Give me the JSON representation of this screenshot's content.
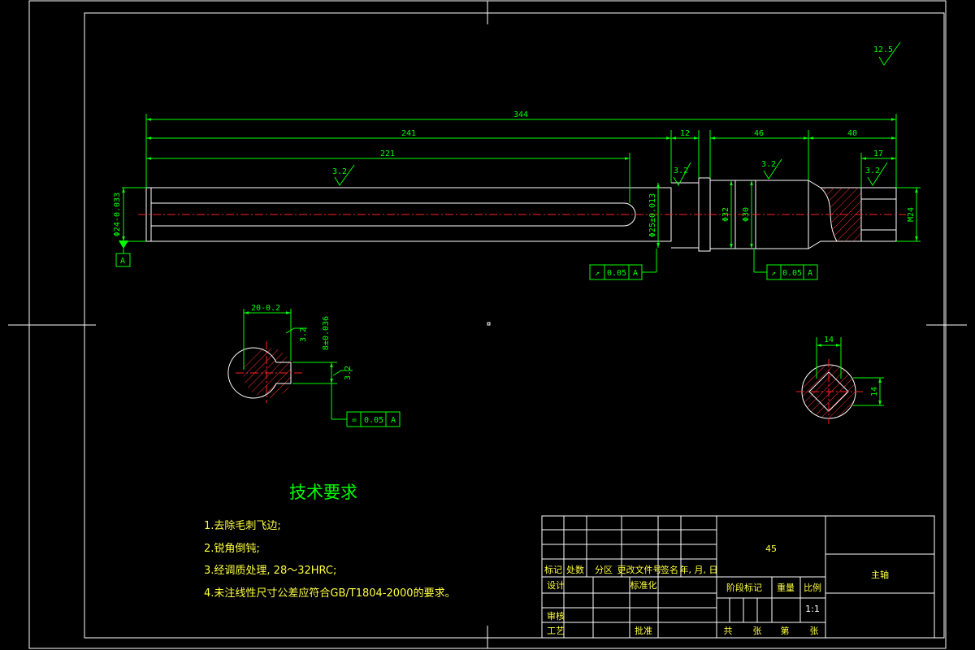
{
  "dimensions": {
    "overall": "344",
    "len_241": "241",
    "len_221": "221",
    "len_12": "12",
    "len_46": "46",
    "len_40": "40",
    "len_17": "17",
    "dia_24": "Φ24-0.033",
    "dia_25": "Φ25±0.013",
    "dia_32": "Φ32",
    "dia_30": "Φ30",
    "m24": "M24",
    "sec1_width": "20-0.2",
    "sec1_key": "8±0.036",
    "sec2_width": "14",
    "sec2_height": "14"
  },
  "roughness": {
    "general": "12.5",
    "shaft": "3.2",
    "shoulder": "3.2",
    "journal": "3.2",
    "thread": "3.2",
    "sec_a": "3.2",
    "sec_b": "3.2"
  },
  "datum": "A",
  "tolerance_frames": [
    {
      "symbol": "↗",
      "value": "0.05",
      "datum": "A"
    },
    {
      "symbol": "↗",
      "value": "0.05",
      "datum": "A"
    },
    {
      "symbol": "=",
      "value": "0.05",
      "datum": "A"
    }
  ],
  "notes": {
    "title": "技术要求",
    "items": [
      "1.去除毛刺飞边;",
      "2.锐角倒钝;",
      "3.经调质处理, 28～32HRC;",
      "4.未注线性尺寸公差应符合GB/T1804-2000的要求。"
    ]
  },
  "title_block": {
    "material": "45",
    "part_name": "主轴",
    "scale": "1:1",
    "h_mark": "标记",
    "h_count": "处数",
    "h_zone": "分区",
    "h_docno": "更改文件号",
    "h_sign": "签名",
    "h_date": "年, 月, 日",
    "design": "设计",
    "standard": "标准化",
    "stage": "阶段标记",
    "weight": "重量",
    "ratio": "比例",
    "review": "审核",
    "process": "工艺",
    "approve": "批准",
    "total": "共",
    "sheets": "张",
    "nth": "第",
    "sheet": "张"
  },
  "colors": {
    "outline": "#ffffff",
    "dimension": "#00ff00",
    "centerline": "#ff2020",
    "notes": "#ffff40"
  }
}
